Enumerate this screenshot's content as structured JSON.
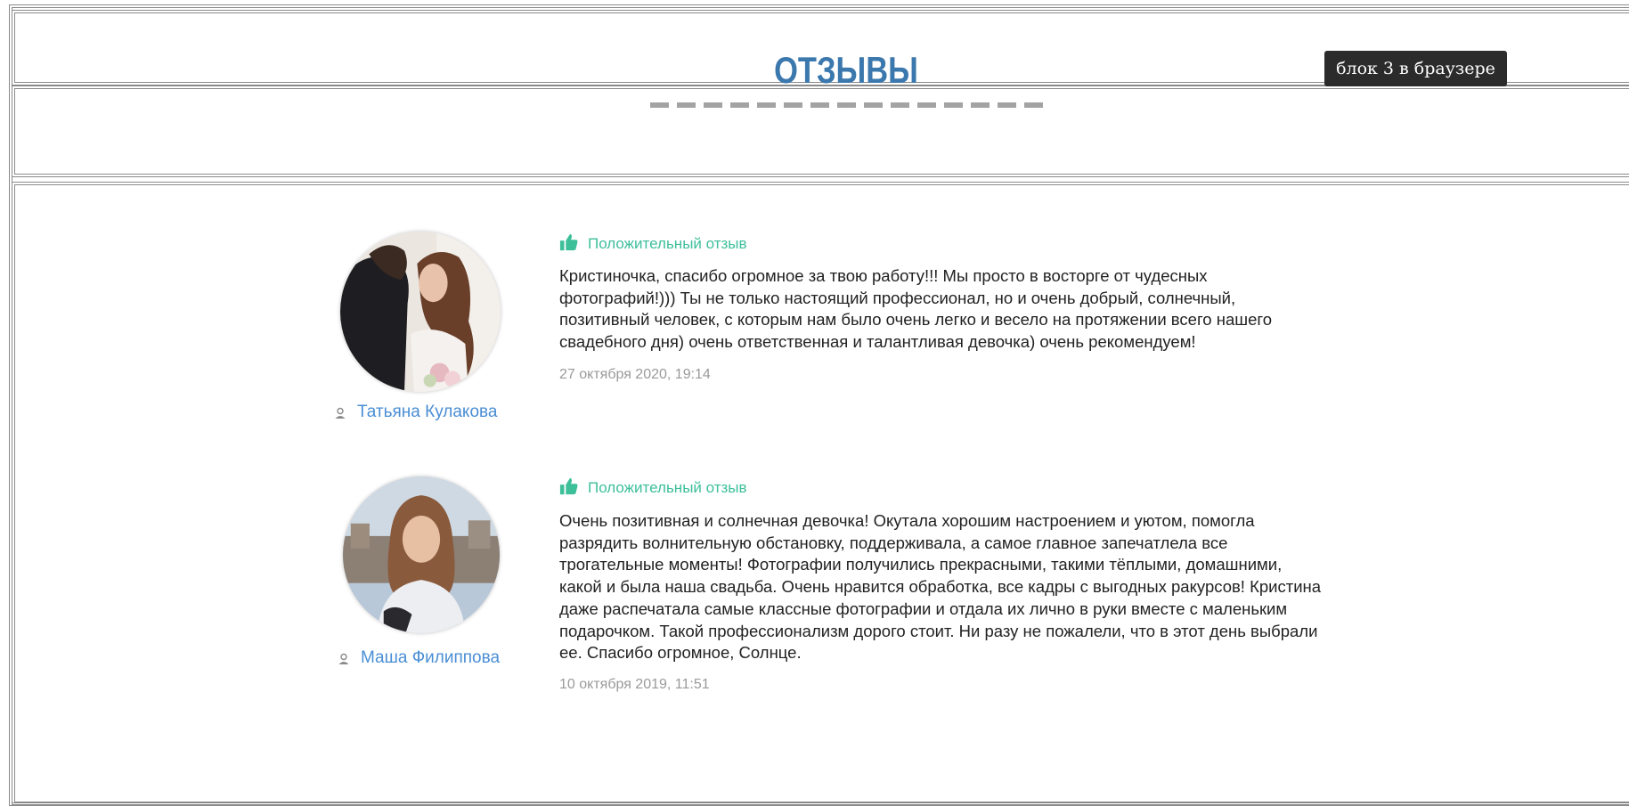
{
  "header": {
    "title": "ОТЗЫВЫ",
    "tooltip": "блок 3 в браузере"
  },
  "reviews": [
    {
      "rating_label": "Положительный отзыв",
      "text": "Кристиночка, спасибо огромное за твою работу!!! Мы просто в восторге от чудесных фотографий!))) Ты не только настоящий профессионал, но и очень добрый, солнечный, позитивный человек, с которым нам было очень легко и весело на протяжении всего нашего свадебного дня) очень ответственная и талантливая девочка) очень рекомендуем!",
      "date": "27 октября 2020, 19:14",
      "author": "Татьяна Кулакова"
    },
    {
      "rating_label": "Положительный отзыв",
      "text": "Очень позитивная и солнечная девочка! Окутала хорошим настроением и уютом, помогла разрядить волнительную обстановку, поддерживала, а самое главное запечатлела все трогательные моменты! Фотографии получились прекрасными, такими тёплыми, домашними, какой и была наша свадьба. Очень нравится обработка, все кадры с выгодных ракурсов! Кристина даже распечатала самые классные фотографии и отдала их лично в руки вместе с маленьким подарочком. Такой профессионализм дорого стоит. Ни разу не пожалели, что в этот день выбрали ее. Спасибо огромное, Солнце.",
      "date": "10 октября 2019, 11:51",
      "author": "Маша Филиппова"
    }
  ],
  "colors": {
    "title": "#3b78ae",
    "positive": "#3dbf9a",
    "author": "#4a8ed4",
    "tooltip_bg": "#2b2b2b"
  },
  "icons": [
    "thumbs-up-icon",
    "user-icon"
  ]
}
